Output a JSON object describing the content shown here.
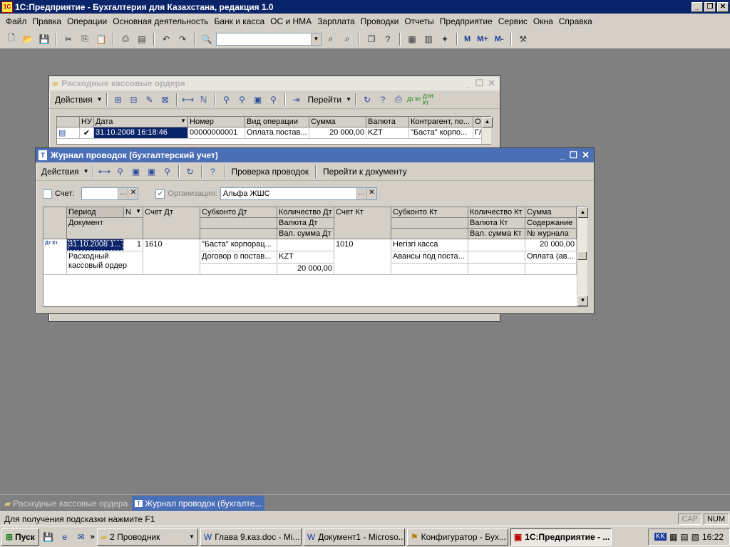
{
  "app": {
    "title": "1С:Предприятие - Бухгалтерия для Казахстана, редакция 1.0",
    "icon_text": "1С"
  },
  "menu": [
    "Файл",
    "Правка",
    "Операции",
    "Основная деятельность",
    "Банк и касса",
    "ОС и НМА",
    "Зарплата",
    "Проводки",
    "Отчеты",
    "Предприятие",
    "Сервис",
    "Окна",
    "Справка"
  ],
  "toolbar": {
    "m_label": "M",
    "mplus_label": "M+",
    "mminus_label": "M-"
  },
  "orders_window": {
    "title": "Расходные кассовые ордера",
    "actions_label": "Действия",
    "goto_label": "Перейти",
    "dt_kt_label": "Дт Кт",
    "dtn_kt_label": "ДтН Кт",
    "columns": [
      "НУ",
      "Дата",
      "Номер",
      "Вид операции",
      "Сумма",
      "Валюта",
      "Контрагент, по...",
      "О"
    ],
    "row": {
      "nu": "✔",
      "date": "31.10.2008 16:18:46",
      "number": "00000000001",
      "operation": "Оплата постав...",
      "sum": "20 000,00",
      "currency": "KZT",
      "counterparty": "\"Баста\" корпо...",
      "o": "Гл"
    }
  },
  "journal_window": {
    "title": "Журнал проводок (бухгалтерский учет)",
    "actions_label": "Действия",
    "check_label": "Проверка проводок",
    "goto_doc_label": "Перейти к документу",
    "account_label": "Счет:",
    "org_label": "Организация:",
    "org_value": "Альфа ЖШС",
    "headers": {
      "period": "Период",
      "n": "N",
      "document": "Документ",
      "schet_dt": "Счет Дт",
      "subkonto_dt": "Субконто Дт",
      "kol_dt": "Количество Дт",
      "val_dt": "Валюта Дт",
      "valsum_dt": "Вал. сумма Дт",
      "schet_kt": "Счет Кт",
      "subkonto_kt": "Субконто Кт",
      "kol_kt": "Количество Кт",
      "val_kt": "Валюта Кт",
      "valsum_kt": "Вал. сумма Кт",
      "summa": "Сумма",
      "content": "Содержание",
      "journal_no": "№ журнала"
    },
    "row": {
      "period": "31.10.2008 1...",
      "n": "1",
      "document": "Расходный кассовый ордер",
      "schet_dt": "1610",
      "subkonto_dt_1": "\"Баста\" корпорац...",
      "subkonto_dt_2": "Договор о постав...",
      "val_dt": "KZT",
      "valsum_dt": "20 000,00",
      "schet_kt": "1010",
      "subkonto_kt_1": "Негізгі касса",
      "subkonto_kt_2": "Авансы под поста...",
      "summa": "20 000,00",
      "content": "Оплата (ав...",
      "row_icon": "Дт Кт"
    }
  },
  "mdi_tabs": [
    "Расходные кассовые ордера",
    "Журнал проводок (бухгалте..."
  ],
  "status": {
    "hint": "Для получения подсказки нажмите F1",
    "cap": "CAP",
    "num": "NUM"
  },
  "taskbar": {
    "start_label": "Пуск",
    "tasks": [
      "2 Проводник",
      "Глава 9.каз.doc - Mi...",
      "Документ1 - Microso...",
      "Конфигуратор - Бух...",
      "1С:Предприятие - ..."
    ],
    "lang": "KK",
    "time": "16:22"
  }
}
